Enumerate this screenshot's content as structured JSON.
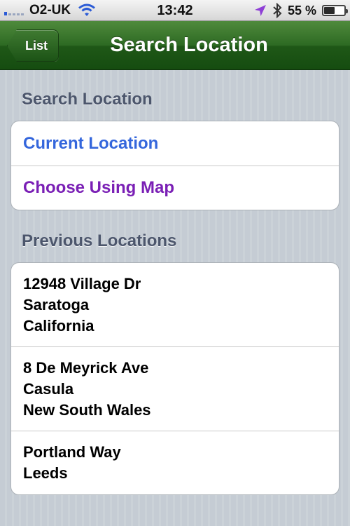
{
  "status_bar": {
    "carrier": "O2-UK",
    "time": "13:42",
    "battery_percent": "55 %",
    "battery_level": 0.55
  },
  "nav": {
    "back_label": "List",
    "title": "Search Location"
  },
  "search_section": {
    "header": "Search Location",
    "items": [
      {
        "label": "Current Location"
      },
      {
        "label": "Choose Using Map"
      }
    ]
  },
  "previous_section": {
    "header": "Previous Locations",
    "locations": [
      {
        "lines": [
          "12948 Village Dr",
          "Saratoga",
          "California"
        ]
      },
      {
        "lines": [
          "8 De Meyrick Ave",
          "Casula",
          "New South Wales"
        ]
      },
      {
        "lines": [
          "Portland Way",
          "Leeds"
        ]
      }
    ]
  },
  "colors": {
    "nav_green": "#2d6a23",
    "current_location_blue": "#3466dc",
    "choose_map_purple": "#7a1fb5"
  }
}
